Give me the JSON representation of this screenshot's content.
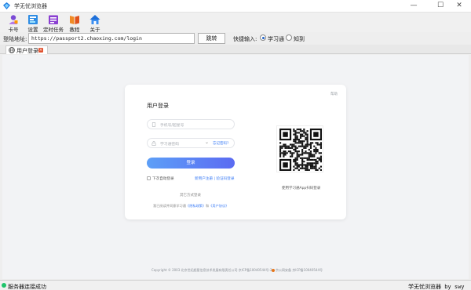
{
  "window": {
    "title": "学无忧浏览器",
    "minimize_glyph": "—",
    "maximize_glyph": "☐",
    "close_glyph": "✕"
  },
  "toolbar": {
    "items": [
      {
        "label": "卡号",
        "icon": "card-icon"
      },
      {
        "label": "设置",
        "icon": "settings-icon"
      },
      {
        "label": "定时任务",
        "icon": "schedule-icon"
      },
      {
        "label": "教程",
        "icon": "book-icon"
      },
      {
        "label": "关于",
        "icon": "home-icon"
      }
    ]
  },
  "address": {
    "label": "登陆地址:",
    "value": "https://passport2.chaoxing.com/login",
    "go_label": "跳转",
    "quick_label": "快捷输入:",
    "options": [
      "学习通",
      "知到"
    ],
    "selected": "学习通"
  },
  "tabs": [
    {
      "label": "用户登录",
      "icon": "globe-icon"
    }
  ],
  "login_page": {
    "corner_text": "帮助",
    "title": "用户登录",
    "phone_placeholder": "手机号/超星号",
    "code_placeholder": "学习通密码",
    "forgot_text": "忘记密码?",
    "login_button": "登录",
    "auto_login": "下次自动登录",
    "new_user_text": "新用户注册 | 验证码登录",
    "org_login_text": "其它方式登录",
    "agreement_prefix": "我已阅读并同意学习通",
    "agreement_link1": "《隐私政策》",
    "agreement_mid": "和",
    "agreement_link2": "《用户协议》",
    "qr_caption": "使用学习通App扫码登录",
    "footer_copyright": "Copyright © 2003 北京世纪超星信息技术发展有限责任公司 京ICP备10040544号-2",
    "footer_icp": "京公网安备 京ICP备10040544号"
  },
  "statusbar": {
    "left_text": "服务器连接成功",
    "right_text": "学无忧浏览器 by swy",
    "status_color": "#1ec46b"
  }
}
